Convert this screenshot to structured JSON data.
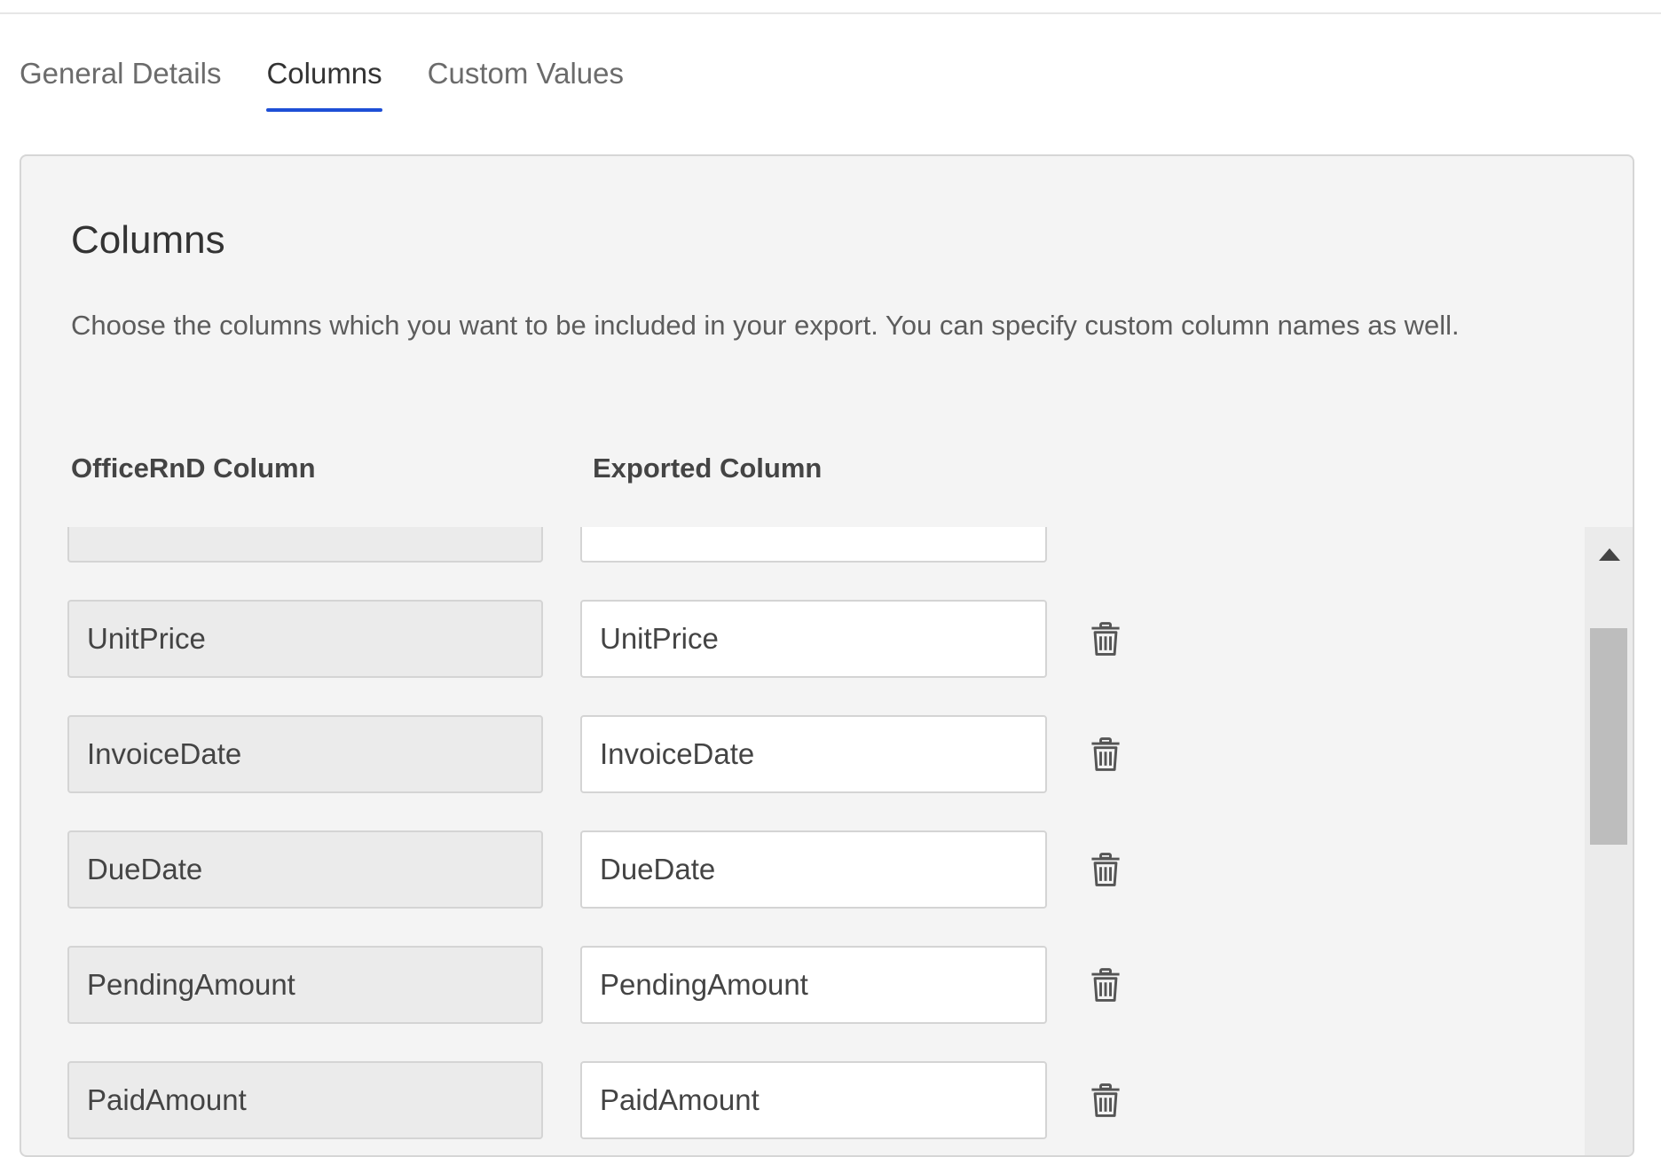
{
  "tabs": [
    {
      "label": "General Details",
      "active": false
    },
    {
      "label": "Columns",
      "active": true
    },
    {
      "label": "Custom Values",
      "active": false
    }
  ],
  "panel": {
    "title": "Columns",
    "description": "Choose the columns which you want to be included in your export. You can specify custom column names as well.",
    "headers": {
      "officernd": "OfficeRnD Column",
      "exported": "Exported Column"
    },
    "rows": [
      {
        "officernd": "",
        "exported": ""
      },
      {
        "officernd": "UnitPrice",
        "exported": "UnitPrice"
      },
      {
        "officernd": "InvoiceDate",
        "exported": "InvoiceDate"
      },
      {
        "officernd": "DueDate",
        "exported": "DueDate"
      },
      {
        "officernd": "PendingAmount",
        "exported": "PendingAmount"
      },
      {
        "officernd": "PaidAmount",
        "exported": "PaidAmount"
      }
    ],
    "row_action_icon": "trash-icon"
  },
  "colors": {
    "accent": "#1e4fd6",
    "panel_bg": "#f4f4f4",
    "locked_field_bg": "#ebebeb"
  }
}
